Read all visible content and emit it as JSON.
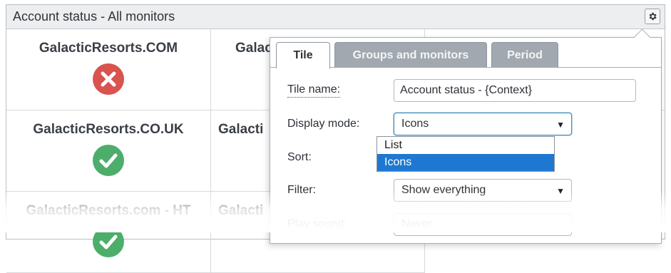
{
  "widget": {
    "title": "Account status - All monitors",
    "settings_icon": "gear-icon"
  },
  "tiles": [
    {
      "name": "GalacticResorts.COM",
      "status": "error",
      "status_icon": "x-circle-icon"
    },
    {
      "name": "Galac",
      "status": "",
      "status_icon": ""
    },
    {
      "name": "GalacticResorts.CO.UK",
      "status": "ok",
      "status_icon": "check-circle-icon"
    },
    {
      "name": "Galacti",
      "status": "",
      "status_icon": ""
    },
    {
      "name": "GalacticResorts.com - HT",
      "status": "ok",
      "status_icon": "check-circle-icon"
    },
    {
      "name": "Galacti",
      "status": "",
      "status_icon": ""
    }
  ],
  "colors": {
    "error": "#d9534f",
    "ok": "#4cae6a",
    "selected_option": "#1e78d2",
    "inactive_tab": "#a1a8b0"
  },
  "settings_panel": {
    "tabs": [
      {
        "label": "Tile",
        "active": true
      },
      {
        "label": "Groups and monitors",
        "active": false
      },
      {
        "label": "Period",
        "active": false
      }
    ],
    "tile_name": {
      "label": "Tile name:",
      "value": "Account status - {Context}"
    },
    "display_mode": {
      "label": "Display mode:",
      "value": "Icons",
      "options": [
        {
          "label": "List",
          "selected": false
        },
        {
          "label": "Icons",
          "selected": true
        }
      ]
    },
    "sort": {
      "label": "Sort:"
    },
    "filter": {
      "label": "Filter:",
      "value": "Show everything"
    },
    "play_sound": {
      "label": "Play sound:",
      "value": "Never"
    }
  }
}
